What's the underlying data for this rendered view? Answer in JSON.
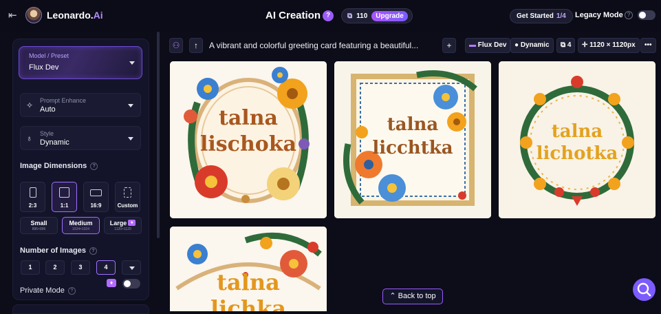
{
  "header": {
    "brand_main": "Leonardo.",
    "brand_ai": "Ai",
    "title": "AI Creation",
    "help_badge": "?",
    "tokens": "110",
    "upgrade": "Upgrade",
    "get_started": "Get Started",
    "get_started_count": "1/4",
    "legacy_mode": "Legacy Mode",
    "legacy_toggle_on": false
  },
  "sidebar": {
    "model_label": "Model / Preset",
    "model_value": "Flux Dev",
    "prompt_enhance_label": "Prompt Enhance",
    "prompt_enhance_value": "Auto",
    "style_label": "Style",
    "style_value": "Dynamic",
    "dimensions_label": "Image Dimensions",
    "ratios": [
      "2:3",
      "1:1",
      "16:9",
      "Custom"
    ],
    "ratio_selected": "1:1",
    "sizes": [
      {
        "name": "Small",
        "dims": "896×896"
      },
      {
        "name": "Medium",
        "dims": "1024×1024"
      },
      {
        "name": "Large",
        "dims": "1120×1120"
      }
    ],
    "size_selected": "Medium",
    "num_images_label": "Number of Images",
    "num_options": [
      "1",
      "2",
      "3",
      "4"
    ],
    "num_selected": "4",
    "private_mode": "Private Mode",
    "private_toggle_on": false
  },
  "prompt_bar": {
    "prompt": "A vibrant and colorful greeting card featuring a beautiful...",
    "model_chip": "Flux Dev",
    "style_chip": "Dynamic",
    "count_chip": "4",
    "size_chip": "1120 × 1120px",
    "more": "•••"
  },
  "images": [
    {
      "line1": "talna",
      "line2": "lischoka",
      "text_color": "#a8571f"
    },
    {
      "line1": "talna",
      "line2": "licchtka",
      "text_color": "#9a5622"
    },
    {
      "line1": "talna",
      "line2": "lichotka",
      "text_color": "#e3a21f"
    },
    {
      "line1": "talna",
      "line2": "lichka",
      "text_color": "#e3971e"
    }
  ],
  "back_to_top": "Back to top",
  "colors": {
    "accent": "#9b5cf6",
    "background": "#0c0d19",
    "panel": "#13142a"
  }
}
